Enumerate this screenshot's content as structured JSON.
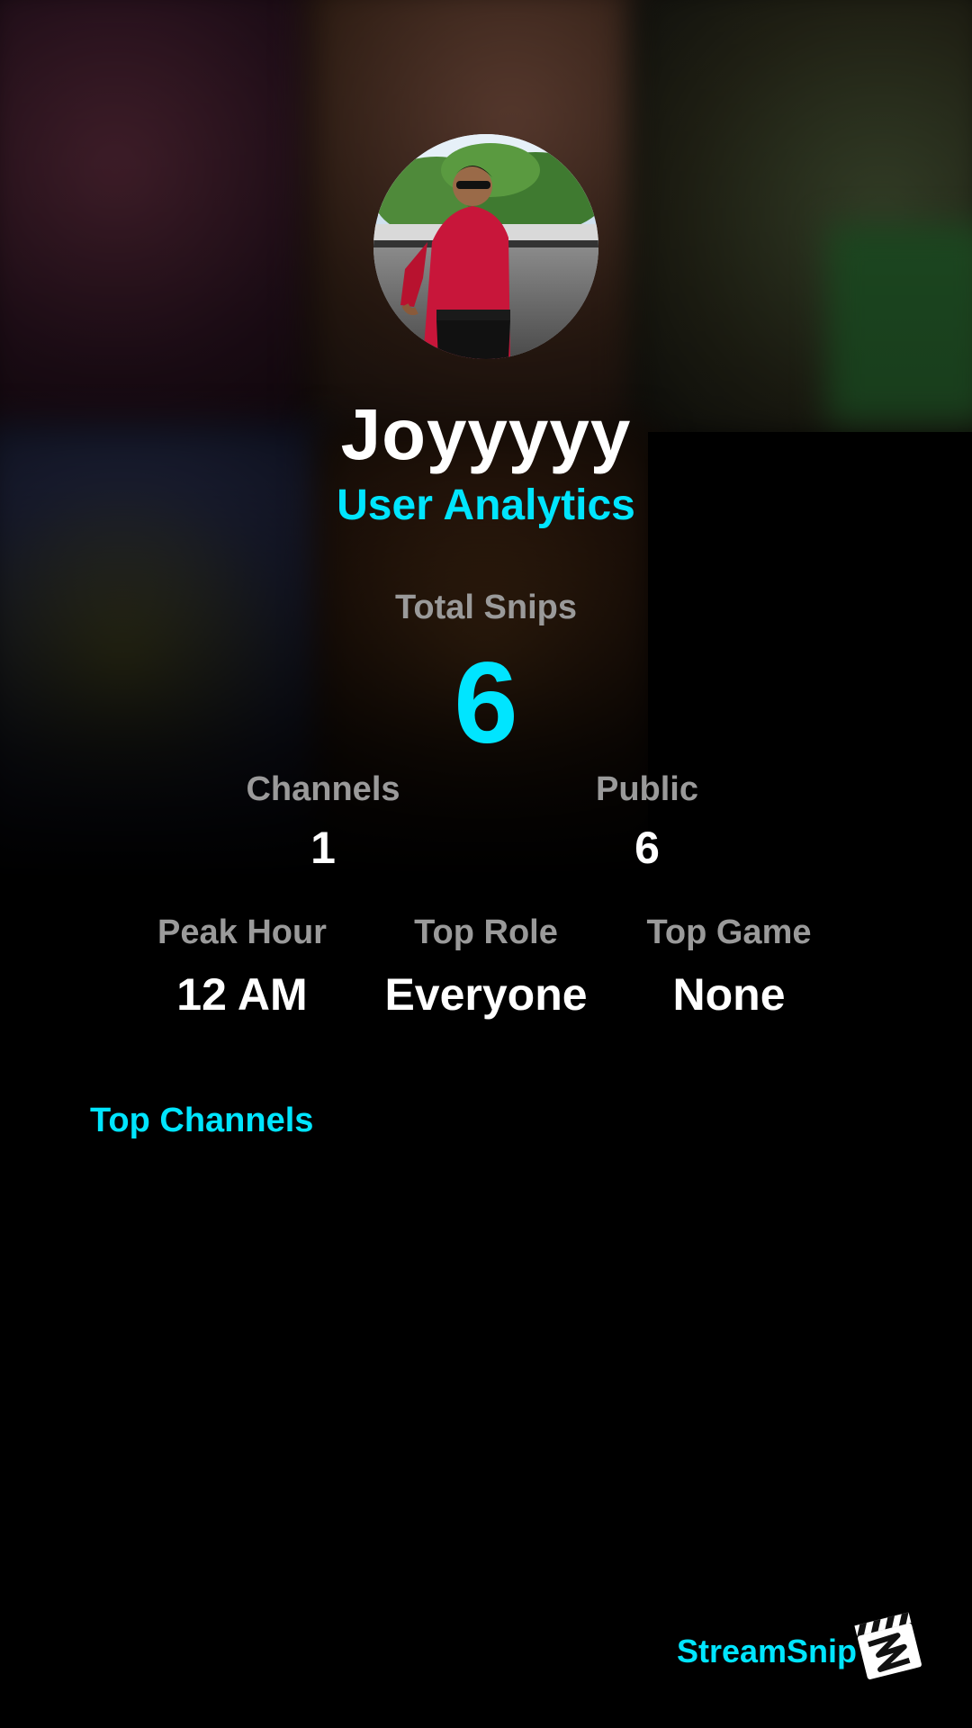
{
  "profile": {
    "username": "Joyyyyy",
    "subtitle": "User Analytics"
  },
  "totals": {
    "label": "Total Snips",
    "value": "6"
  },
  "row1": [
    {
      "label": "Channels",
      "value": "1"
    },
    {
      "label": "Public",
      "value": "6"
    }
  ],
  "row2": [
    {
      "label": "Peak Hour",
      "value": "12 AM"
    },
    {
      "label": "Top Role",
      "value": "Everyone"
    },
    {
      "label": "Top Game",
      "value": "None"
    }
  ],
  "sections": {
    "top_channels": "Top Channels"
  },
  "branding": {
    "name": "StreamSnip",
    "logo_icon": "clapperboard-icon"
  },
  "colors": {
    "accent": "#00e5ff",
    "label": "#9a9a9a",
    "value": "#ffffff",
    "background": "#000000"
  }
}
